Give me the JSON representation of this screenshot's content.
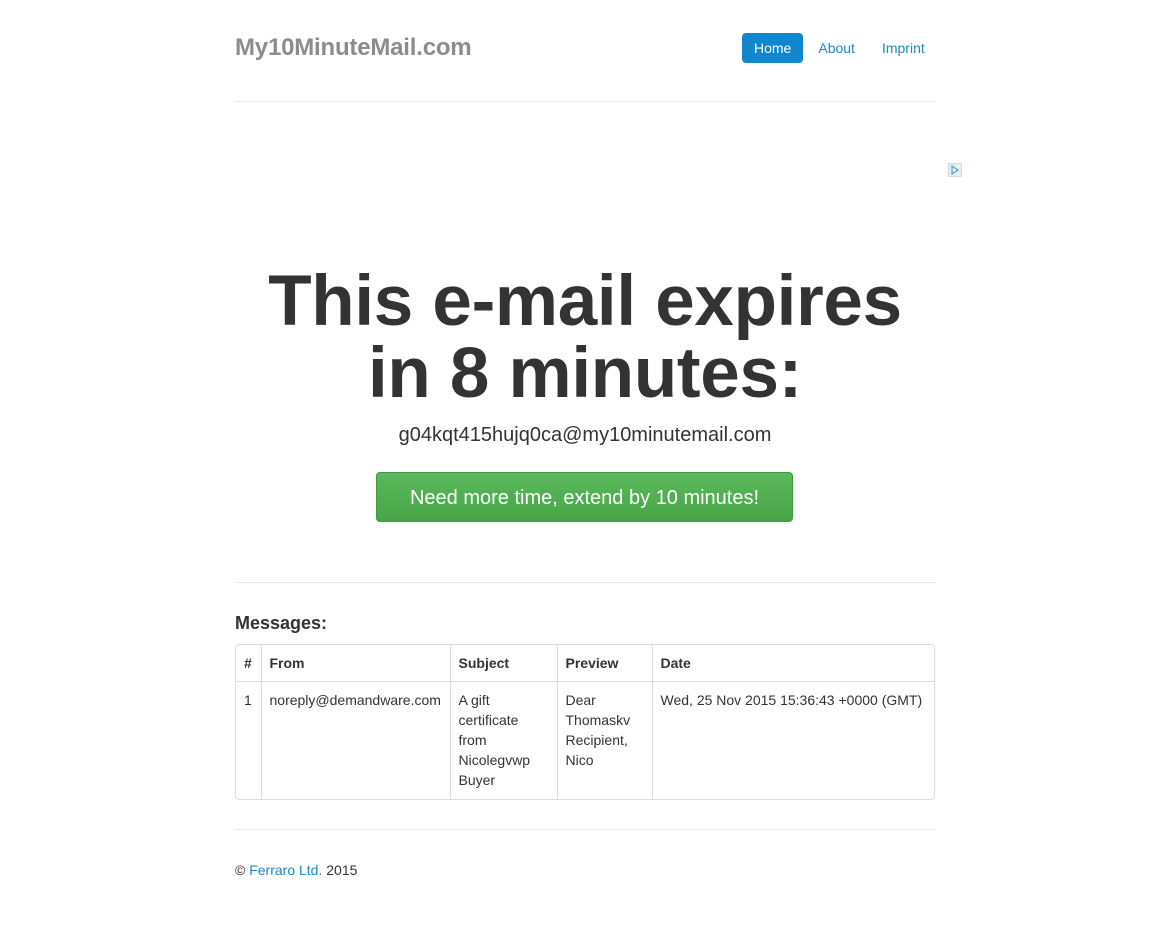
{
  "header": {
    "brand": "My10MinuteMail.com",
    "nav": [
      "Home",
      "About",
      "Imprint"
    ]
  },
  "hero": {
    "headline_line1": "This e-mail expires",
    "headline_line2": "in 8 minutes:",
    "email": "g04kqt415hujq0ca@my10minutemail.com",
    "extend_button": "Need more time, extend by 10 minutes!"
  },
  "messages": {
    "title": "Messages:",
    "columns": [
      "#",
      "From",
      "Subject",
      "Preview",
      "Date"
    ],
    "rows": [
      {
        "num": "1",
        "from": "noreply@demandware.com",
        "subject": "A gift certificate from Nicolegvwp Buyer",
        "preview": "Dear Thomaskv Recipient, Nico",
        "date": "Wed, 25 Nov 2015 15:36:43 +0000 (GMT)"
      }
    ]
  },
  "footer": {
    "copyright_symbol": "©",
    "company_link": "Ferraro Ltd.",
    "year": "2015"
  },
  "colors": {
    "accent": "#1086cf",
    "link": "#1a8bc7",
    "button_green": "#5cb85c"
  },
  "icons": {
    "ad_choices": "adchoices-icon"
  }
}
